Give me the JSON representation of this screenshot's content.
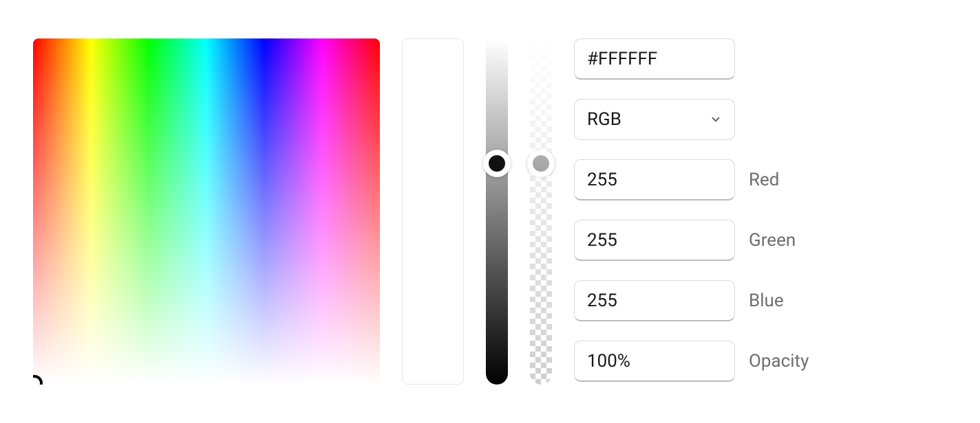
{
  "hex": {
    "value": "#FFFFFF"
  },
  "mode": {
    "selected": "RGB"
  },
  "channels": [
    {
      "value": "255",
      "label": "Red"
    },
    {
      "value": "255",
      "label": "Green"
    },
    {
      "value": "255",
      "label": "Blue"
    },
    {
      "value": "100%",
      "label": "Opacity"
    }
  ]
}
